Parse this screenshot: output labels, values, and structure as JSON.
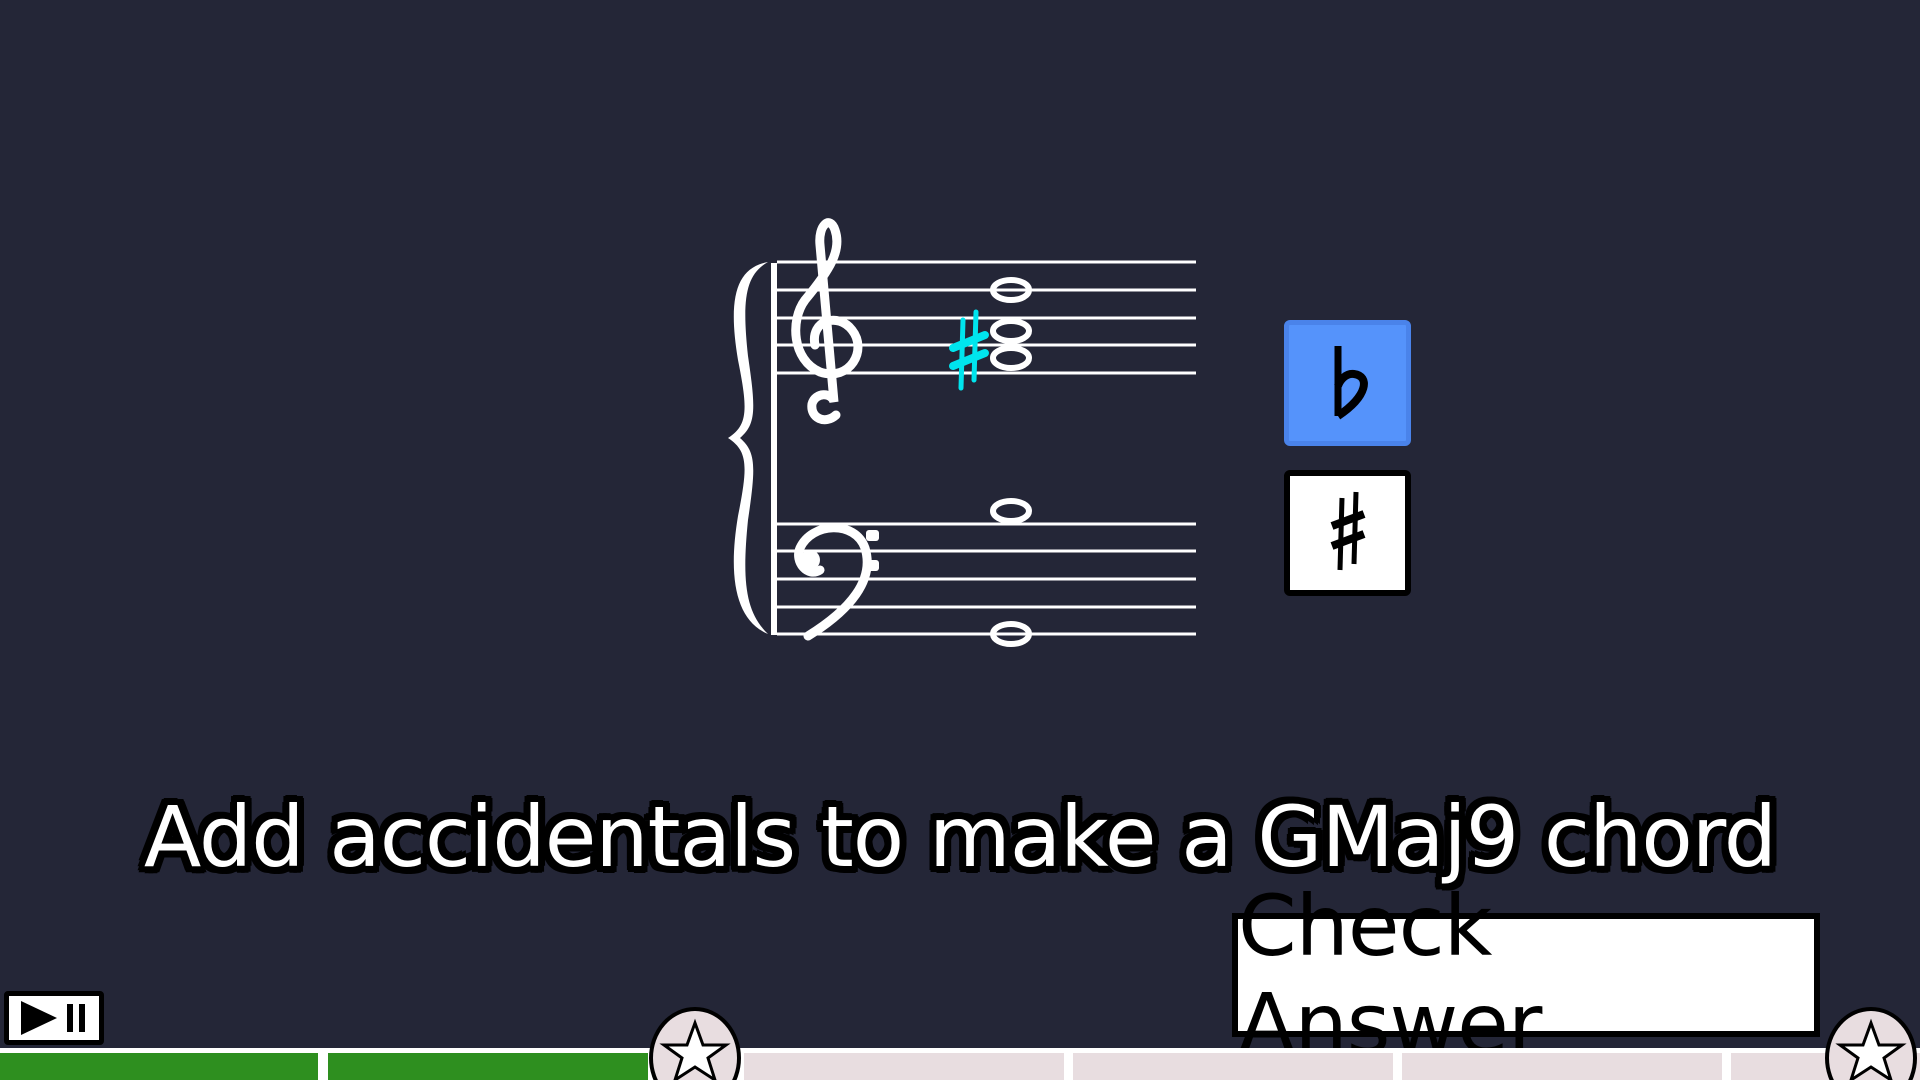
{
  "game": {
    "prompt": "Add accidentals to make a GMaj9 chord",
    "check_button_label": "Check Answer"
  },
  "staff": {
    "clefs": [
      "treble-clef",
      "bass-clef"
    ],
    "placed_accidental": "sharp",
    "placed_accidental_color": "#00e5ee",
    "note_count_treble": 3,
    "note_count_bass": 2
  },
  "accidental_buttons": [
    {
      "name": "flat",
      "icon": "flat-icon",
      "selected": true,
      "color": "#5593fb"
    },
    {
      "name": "sharp",
      "icon": "sharp-icon",
      "selected": false,
      "color": "#ffffff"
    }
  ],
  "progress": {
    "segments_total": 6,
    "segments_completed": 2,
    "completed_color": "#2e8f1f",
    "pending_color": "#e8dde0",
    "milestones": [
      "star-icon",
      "star-icon"
    ]
  },
  "controls": {
    "play_pause_icon": "play-pause-icon"
  },
  "colors": {
    "background": "#242637"
  }
}
